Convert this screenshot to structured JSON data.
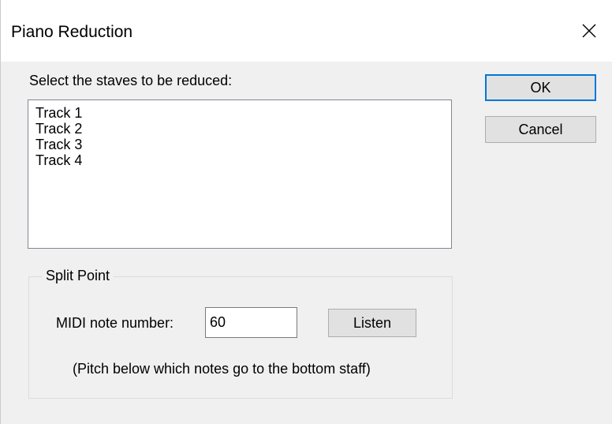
{
  "dialog": {
    "title": "Piano Reduction",
    "close_icon": "close-icon"
  },
  "staves": {
    "prompt": "Select the staves to be reduced:",
    "items": [
      "Track 1",
      "Track 2",
      "Track 3",
      "Track 4"
    ]
  },
  "buttons": {
    "ok": "OK",
    "cancel": "Cancel",
    "listen": "Listen"
  },
  "split_point": {
    "group_title": "Split Point",
    "midi_label": "MIDI note number:",
    "midi_value": "60",
    "hint": "(Pitch below which notes go to the bottom staff)"
  },
  "colors": {
    "focus_border": "#0078d7",
    "button_face": "#e1e1e1",
    "dialog_bg": "#f0f0f0"
  }
}
